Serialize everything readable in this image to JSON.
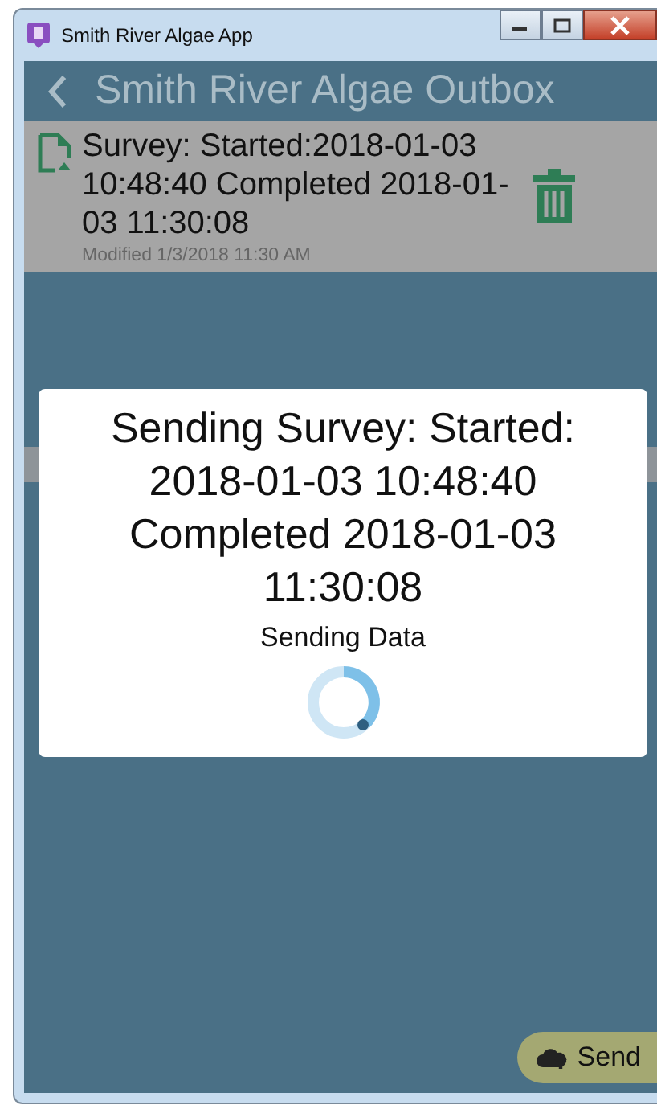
{
  "window": {
    "title": "Smith River Algae App"
  },
  "header": {
    "title": "Smith River Algae Outbox"
  },
  "outbox": [
    {
      "title": "Survey: Started:2018-01-03 10:48:40 Completed 2018-01-03 11:30:08",
      "modified": "Modified 1/3/2018 11:30 AM"
    }
  ],
  "dialog": {
    "title": "Sending Survey: Started: 2018-01-03 10:48:40 Completed 2018-01-03 11:30:08",
    "status": "Sending Data"
  },
  "send_button": {
    "label": "Send"
  }
}
